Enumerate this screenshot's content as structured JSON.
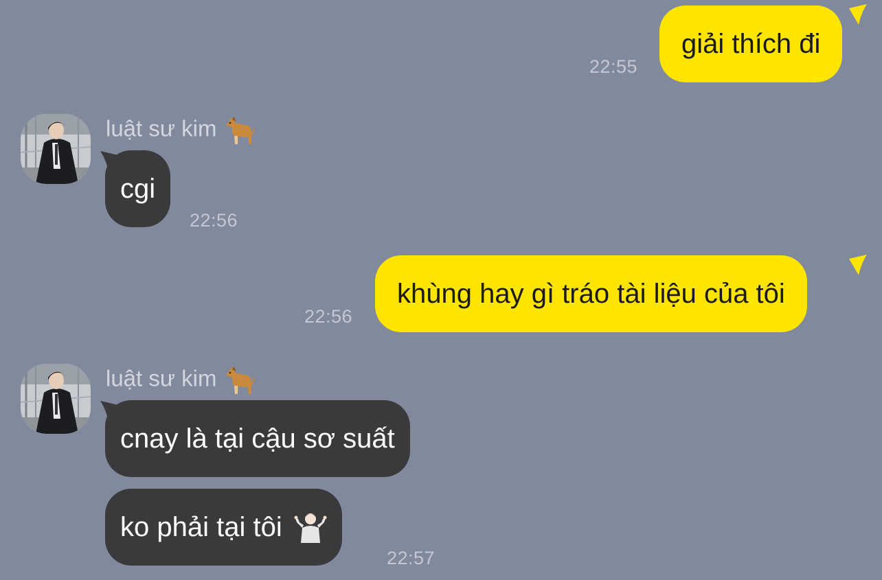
{
  "messages": [
    {
      "text": "giải thích đi",
      "time": "22:55"
    },
    {
      "sender": "luật sư kim",
      "sender_icon": "dog-emoji-icon",
      "text": "cgi",
      "time": "22:56"
    },
    {
      "text": "khùng hay gì tráo tài liệu của tôi",
      "time": "22:56"
    },
    {
      "sender": "luật sư kim",
      "sender_icon": "dog-emoji-icon",
      "texts": [
        "cnay là tại cậu sơ suất",
        "ko phải tại tôi"
      ],
      "last_icon": "person-shrugging-icon",
      "time": "22:57"
    }
  ],
  "colors": {
    "background": "#818a9d",
    "outgoing_bubble": "#fee500",
    "incoming_bubble": "#3a3a3c"
  }
}
